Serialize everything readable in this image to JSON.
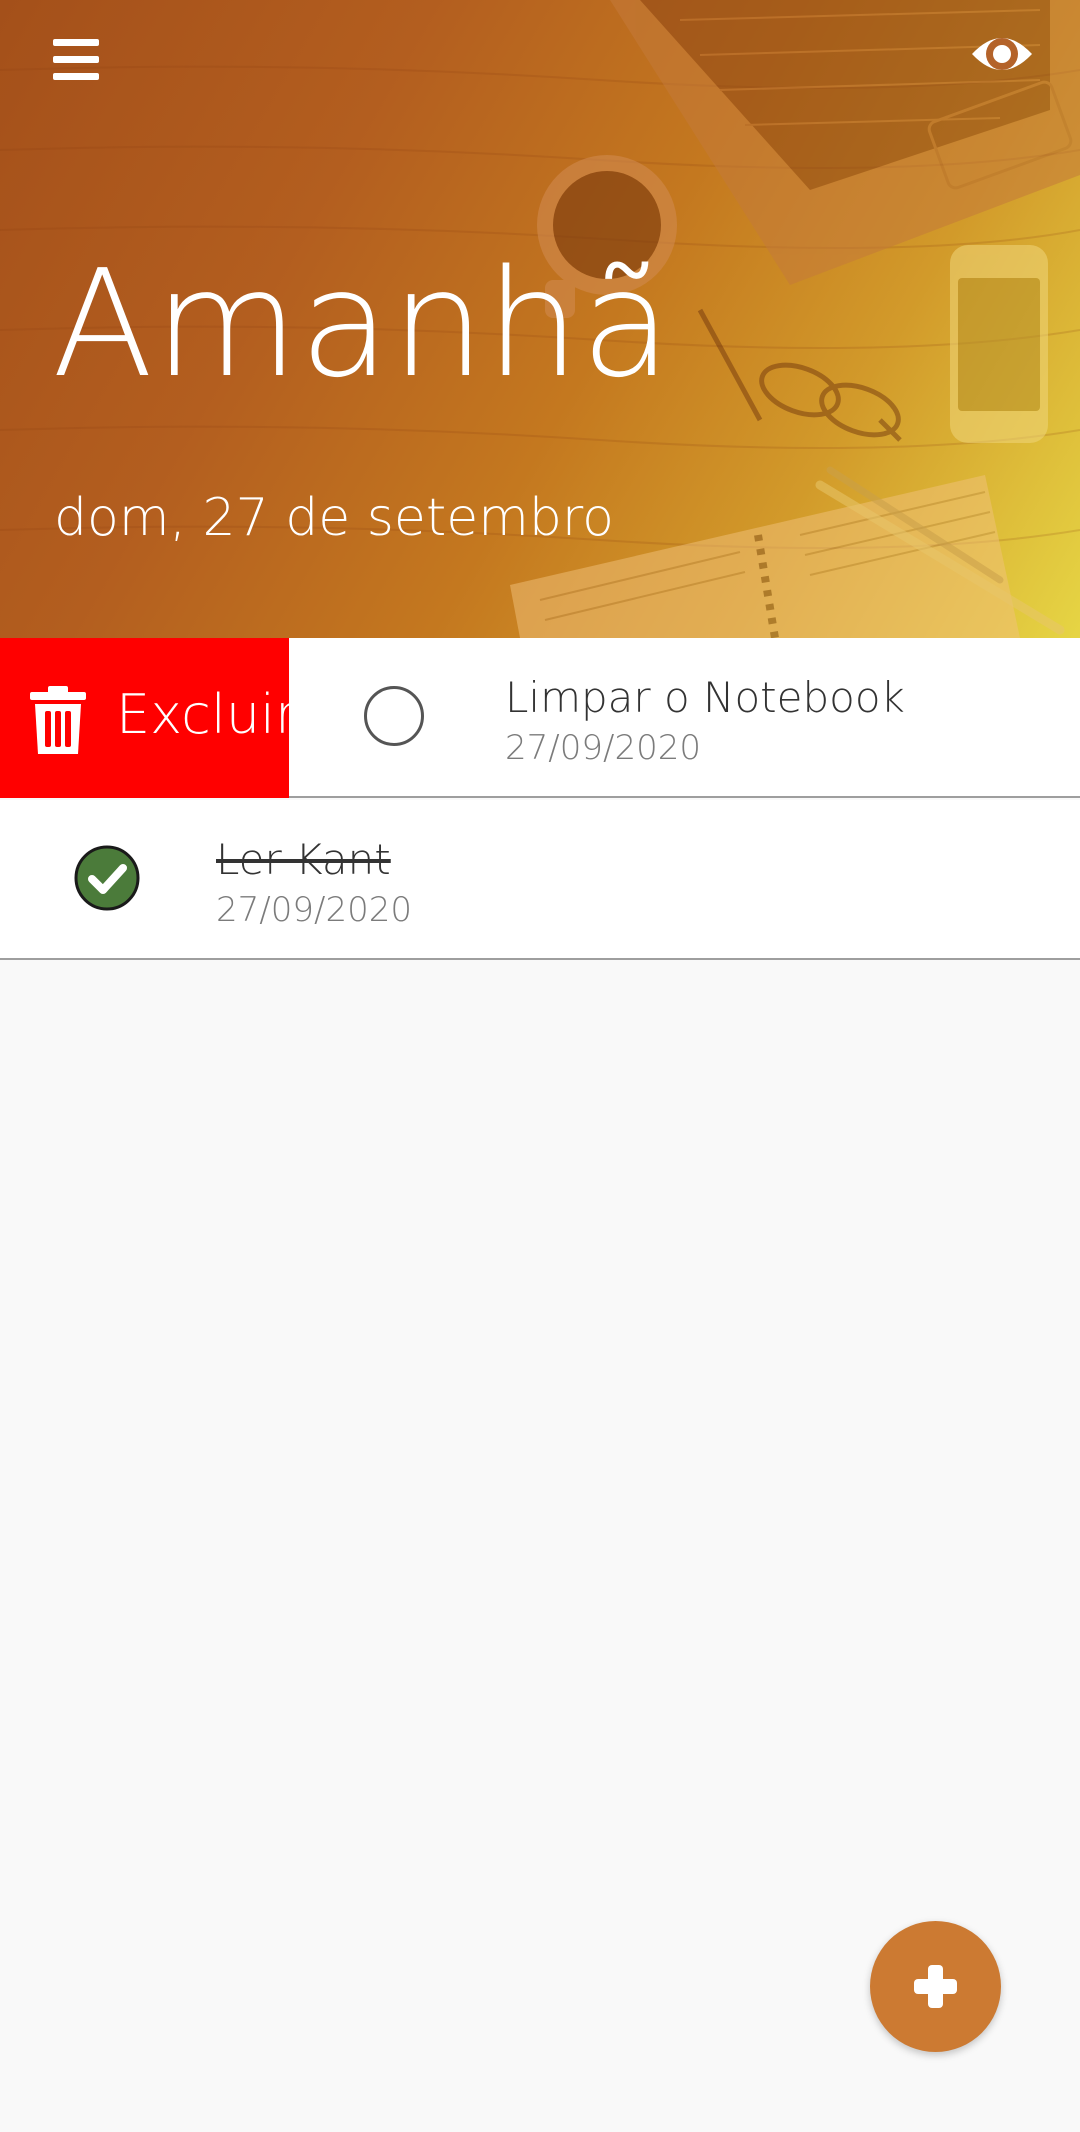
{
  "header": {
    "title": "Amanhã",
    "subtitle": "dom, 27 de setembro",
    "menu_icon": "hamburger-menu-icon",
    "visibility_icon": "eye-icon",
    "background_image": "desk with laptop, coffee cup, smartphone, glasses and notebook"
  },
  "tasks": [
    {
      "title": "Limpar o Notebook",
      "date": "27/09/2020",
      "completed": false,
      "swipe_action": {
        "label": "Excluir",
        "icon": "trash-icon",
        "color": "#ff0000"
      }
    },
    {
      "title": "Ler Kant",
      "date": "27/09/2020",
      "completed": true
    }
  ],
  "fab": {
    "icon": "plus-icon",
    "color": "#cc7a32"
  },
  "colors": {
    "accent": "#cc7a32",
    "completed_check": "#4b7b3a",
    "delete": "#ff0000"
  }
}
